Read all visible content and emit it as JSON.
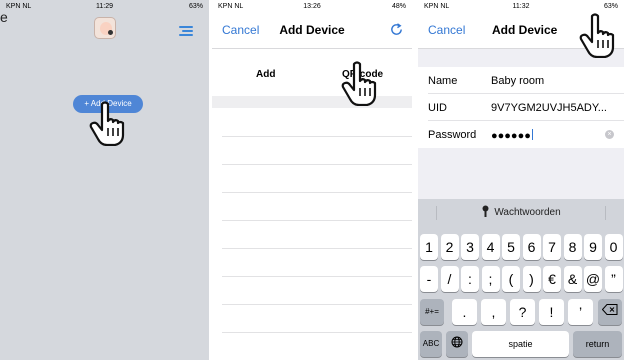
{
  "left_edge_letter": "e",
  "panel1": {
    "status": {
      "carrier": "KPN NL",
      "time": "11:29",
      "battery": "63%"
    },
    "add_button": "+ Add Device"
  },
  "panel2": {
    "status": {
      "carrier": "KPN NL",
      "time": "13:26",
      "battery": "48%"
    },
    "nav": {
      "cancel": "Cancel",
      "title": "Add Device"
    },
    "segments": {
      "add": "Add",
      "qr": "QR code"
    }
  },
  "panel3": {
    "status": {
      "carrier": "KPN NL",
      "time": "11:32",
      "battery": "63%"
    },
    "nav": {
      "cancel": "Cancel",
      "title": "Add Device"
    },
    "fields": {
      "name": {
        "label": "Name",
        "value": "Baby room"
      },
      "uid": {
        "label": "UID",
        "value": "9V7YGM2UVJH5ADY..."
      },
      "password": {
        "label": "Password",
        "value": "●●●●●●"
      }
    },
    "keyboard": {
      "suggestion": "Wachtwoorden",
      "row1": [
        "1",
        "2",
        "3",
        "4",
        "5",
        "6",
        "7",
        "8",
        "9",
        "0"
      ],
      "row2": [
        "-",
        "/",
        ":",
        ";",
        "(",
        ")",
        "€",
        "&",
        "@",
        "”"
      ],
      "row3": [
        ".",
        ",",
        "?",
        "!",
        "’"
      ],
      "shift_label": "#+=",
      "abc_label": "ABC",
      "space_label": "spatie",
      "return_label": "return"
    }
  },
  "colors": {
    "accent": "#3478d4",
    "pill": "#4f86d6",
    "panel1_bg": "#d5d8dd",
    "keyboard_bg": "#d1d4da"
  }
}
